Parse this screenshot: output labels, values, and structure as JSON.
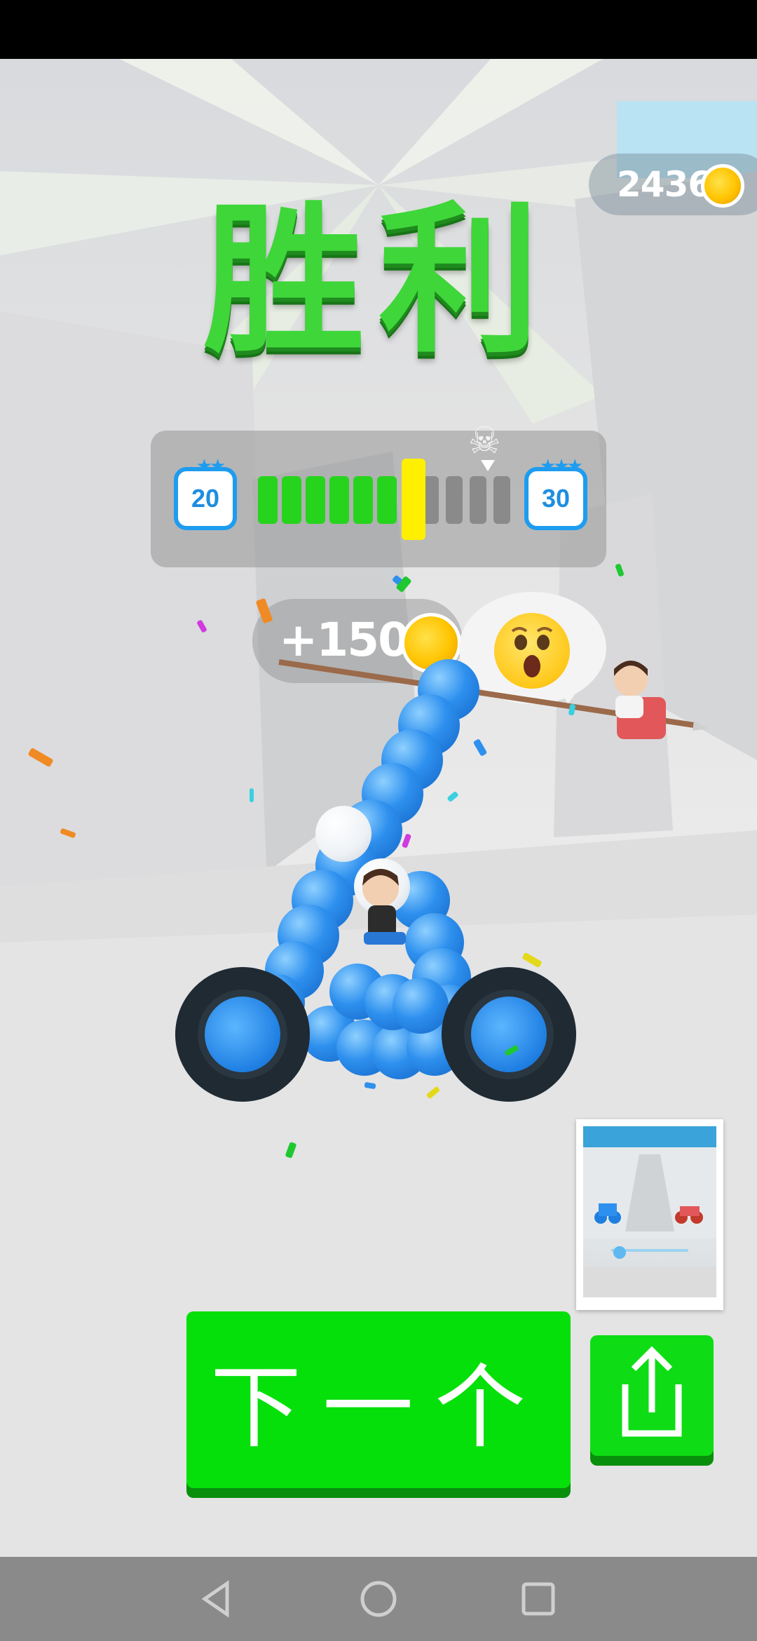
{
  "hud": {
    "coins": "2436",
    "title": "胜利"
  },
  "level_progress": {
    "current_level": "20",
    "next_level": "30",
    "progress_fraction": 0.625
  },
  "reward": {
    "amount": "+150"
  },
  "buttons": {
    "next_label": "下一个"
  },
  "icons": {
    "coin": "coin-icon",
    "boss": "skull-icon",
    "reaction": "surprised-emoji-icon",
    "share": "share-icon",
    "back": "nav-back-icon",
    "home": "nav-home-icon",
    "recents": "nav-recents-icon"
  },
  "colors": {
    "title_green": "#3fd63a",
    "button_green": "#06e00a",
    "progress_green": "#26d41d",
    "marker_yellow": "#ffef00",
    "badge_blue": "#1e9cf0"
  }
}
